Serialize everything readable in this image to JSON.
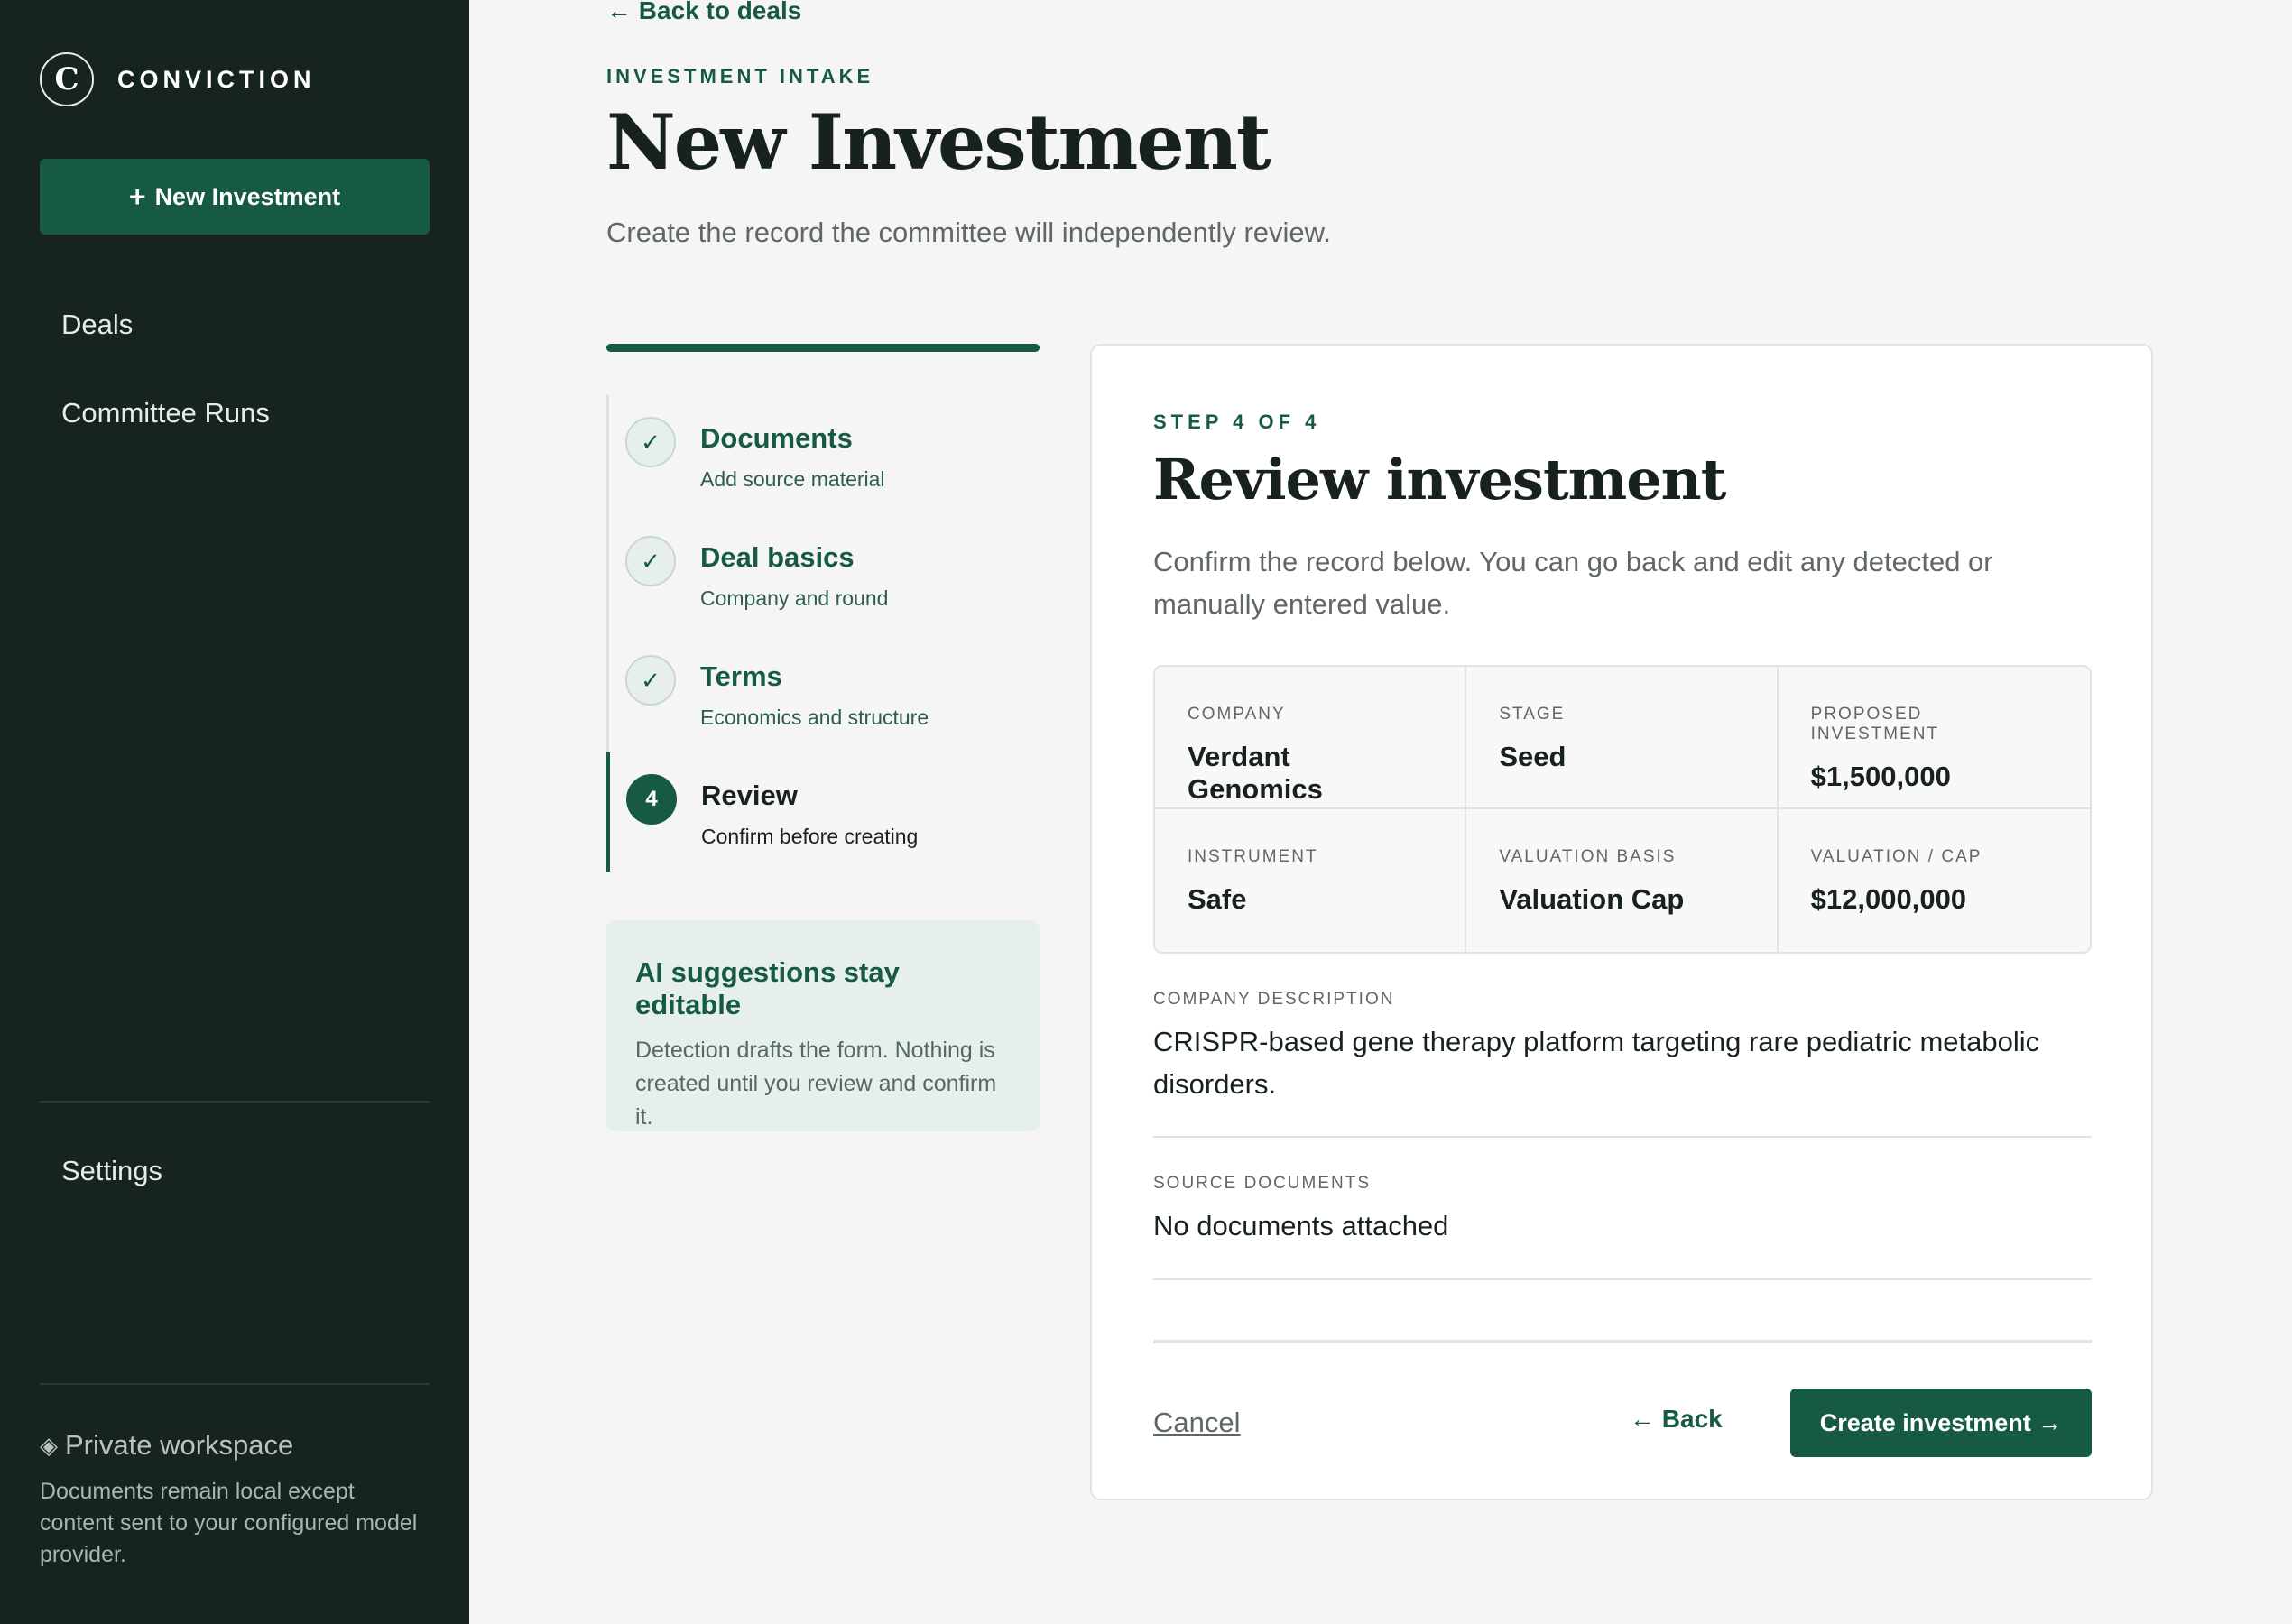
{
  "sidebar": {
    "brand_mark": "C",
    "brand_name": "CONVICTION",
    "new_button_icon": "+",
    "new_button_label": "New Investment",
    "nav": [
      "Deals",
      "Committee Runs"
    ],
    "settings_label": "Settings",
    "private_icon": "◈",
    "private_label": "Private workspace",
    "private_note": "Documents remain local except content sent to your configured model provider."
  },
  "header": {
    "back_link": "← Back to deals",
    "eyebrow": "INVESTMENT INTAKE",
    "title": "New Investment",
    "subtitle": "Create the record the committee will independently review."
  },
  "progress_fraction": 1.0,
  "steps": [
    {
      "marker": "✓",
      "title": "Documents",
      "desc": "Add source material"
    },
    {
      "marker": "✓",
      "title": "Deal basics",
      "desc": "Company and round"
    },
    {
      "marker": "✓",
      "title": "Terms",
      "desc": "Economics and structure"
    },
    {
      "marker": "4",
      "title": "Review",
      "desc": "Confirm before creating"
    }
  ],
  "ai_box": {
    "title": "AI suggestions stay editable",
    "body": "Detection drafts the form. Nothing is created until you review and confirm it."
  },
  "card": {
    "eyebrow": "STEP 4 OF 4",
    "title": "Review investment",
    "subtitle": "Confirm the record below. You can go back and edit any detected or manually entered value.",
    "fields": [
      {
        "label": "COMPANY",
        "value": "Verdant Genomics"
      },
      {
        "label": "STAGE",
        "value": "Seed"
      },
      {
        "label": "PROPOSED INVESTMENT",
        "value": "$1,500,000"
      },
      {
        "label": "INSTRUMENT",
        "value": "Safe"
      },
      {
        "label": "VALUATION BASIS",
        "value": "Valuation Cap"
      },
      {
        "label": "VALUATION / CAP",
        "value": "$12,000,000"
      }
    ],
    "description_label": "COMPANY DESCRIPTION",
    "description_value": "CRISPR-based gene therapy platform targeting rare pediatric metabolic disorders.",
    "documents_label": "SOURCE DOCUMENTS",
    "documents_value": "No documents attached",
    "cancel_label": "Cancel",
    "back_label": "← Back",
    "create_label": "Create investment →"
  },
  "colors": {
    "sidebar_bg": "#16231e",
    "accent": "#165a41",
    "page_bg": "#f5f6f4"
  }
}
